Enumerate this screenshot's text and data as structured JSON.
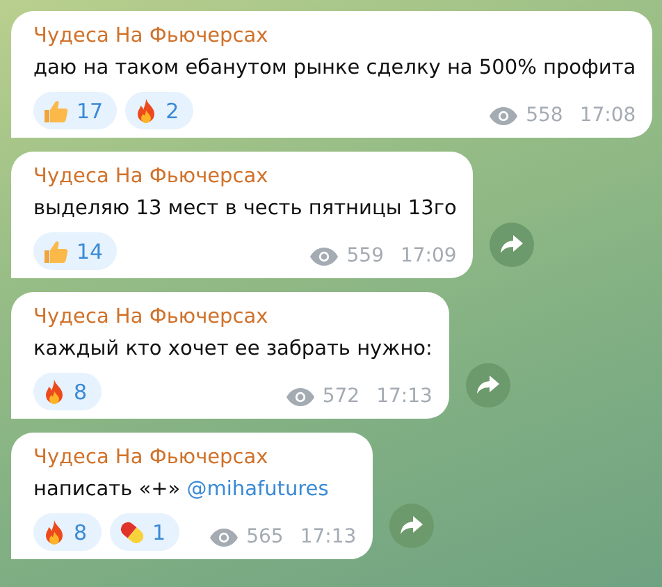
{
  "messages": [
    {
      "author": "Чудеса На Фьючерсах",
      "text": "даю на таком ебанутом рынке сделку на 500% профита",
      "reactions": [
        {
          "kind": "thumbs_up",
          "count": "17"
        },
        {
          "kind": "fire",
          "count": "2"
        }
      ],
      "views": "558",
      "time": "17:08",
      "forward": false
    },
    {
      "author": "Чудеса На Фьючерсах",
      "text": "выделяю 13 мест в честь пятницы 13го",
      "reactions": [
        {
          "kind": "thumbs_up",
          "count": "14"
        }
      ],
      "views": "559",
      "time": "17:09",
      "forward": true
    },
    {
      "author": "Чудеса На Фьючерсах",
      "text": "каждый кто хочет ее забрать нужно:",
      "reactions": [
        {
          "kind": "fire",
          "count": "8"
        }
      ],
      "views": "572",
      "time": "17:13",
      "forward": true
    },
    {
      "author": "Чудеса На Фьючерсах",
      "text": "написать «+»",
      "link": "@mihafutures",
      "reactions": [
        {
          "kind": "fire",
          "count": "8"
        },
        {
          "kind": "pill",
          "count": "1"
        }
      ],
      "views": "565",
      "time": "17:13",
      "forward": true
    }
  ]
}
